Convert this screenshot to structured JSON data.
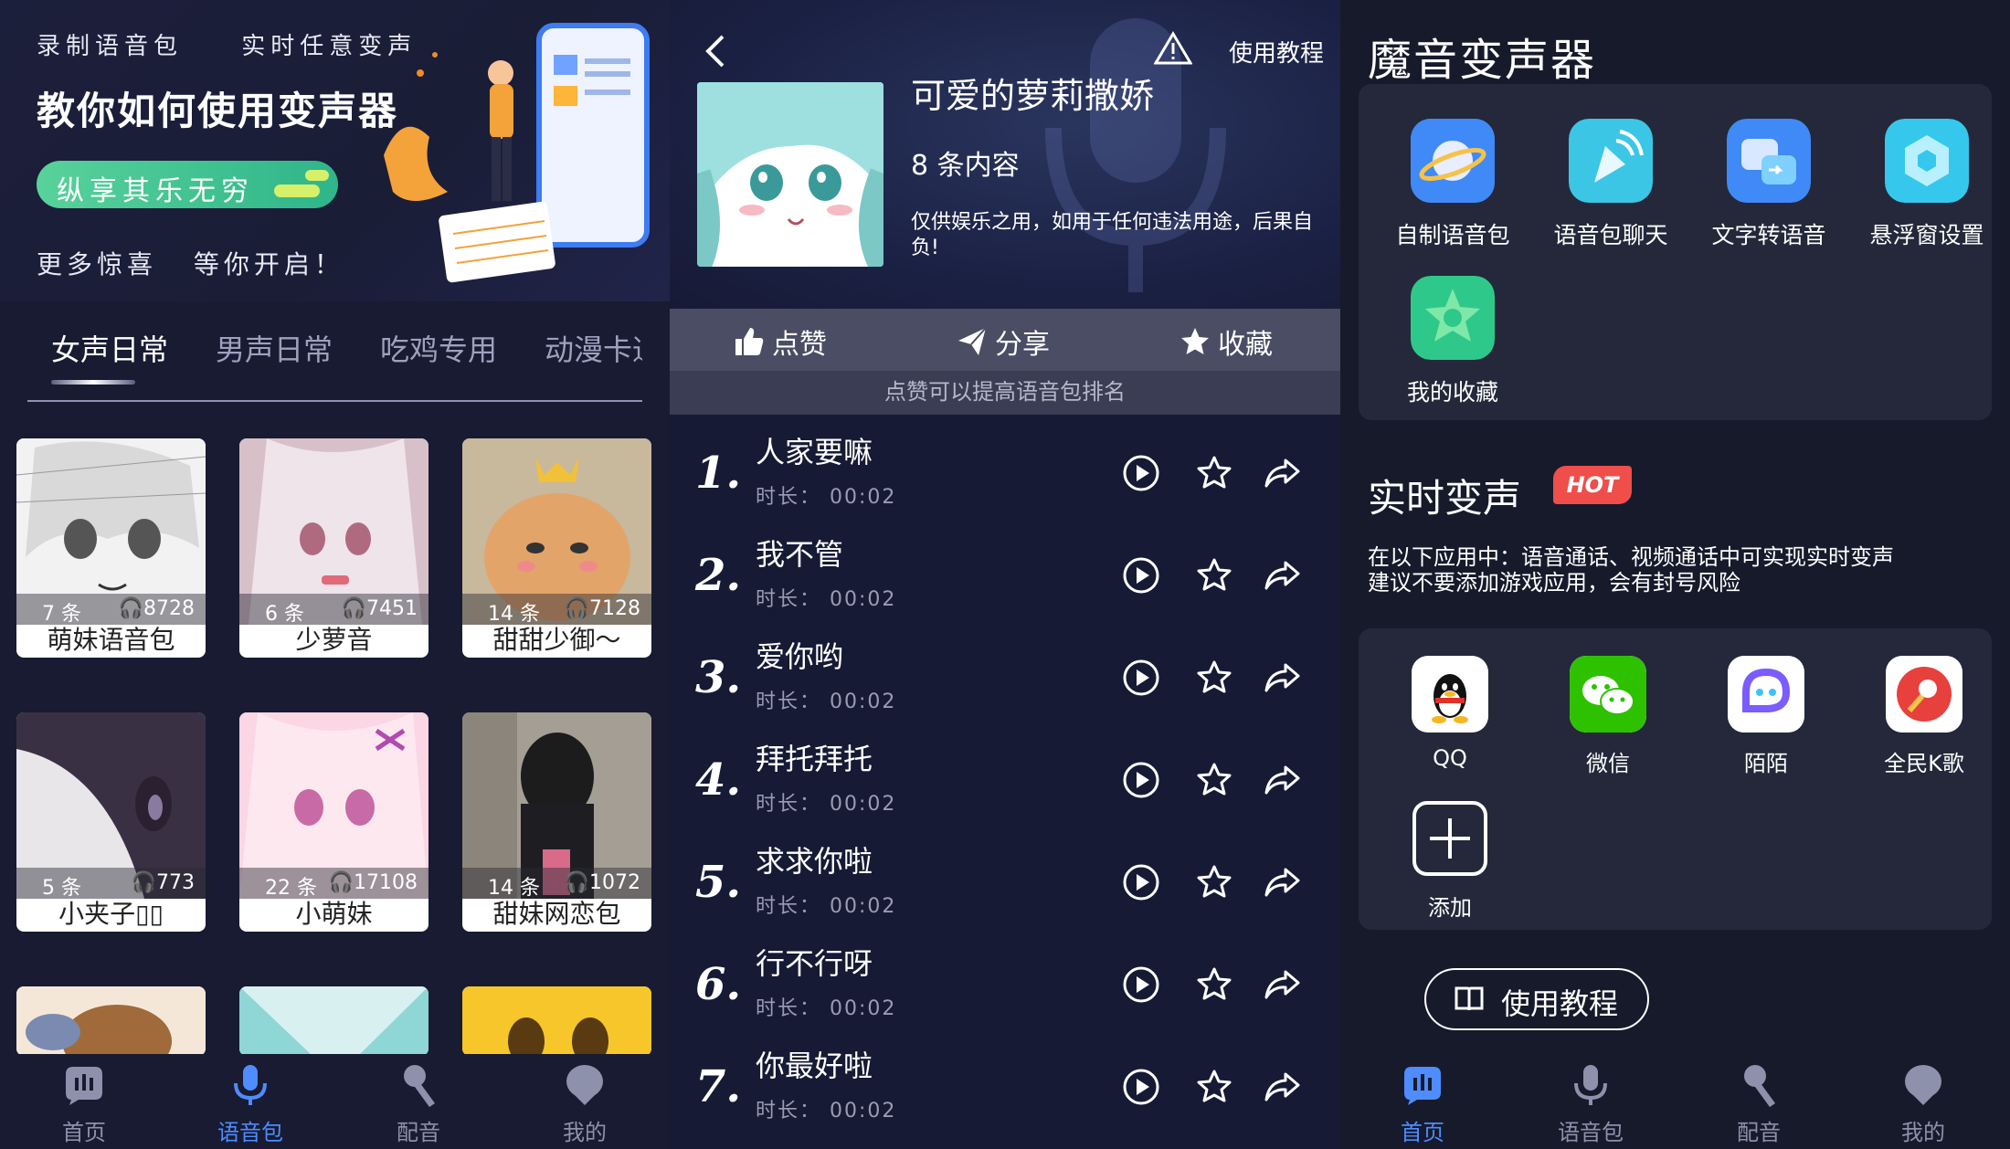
{
  "panel1": {
    "banner": {
      "top_left": "录制语音包",
      "top_right": "实时任意变声",
      "title": "教你如何使用变声器",
      "pill": "纵享其乐无穷",
      "sub_left": "更多惊喜",
      "sub_right": "等你开启！"
    },
    "tabs": [
      "女声日常",
      "男声日常",
      "吃鸡专用",
      "动漫卡通"
    ],
    "cards": [
      {
        "name": "萌妹语音包",
        "count": "7 条",
        "plays": "8728"
      },
      {
        "name": "少萝音",
        "count": "6 条",
        "plays": "7451"
      },
      {
        "name": "甜甜少御～",
        "count": "14 条",
        "plays": "7128"
      },
      {
        "name": "小夹子▯▯",
        "count": "5 条",
        "plays": "773"
      },
      {
        "name": "小萌妹",
        "count": "22 条",
        "plays": "17108"
      },
      {
        "name": "甜妹网恋包",
        "count": "14 条",
        "plays": "1072"
      }
    ],
    "nav": [
      "首页",
      "语音包",
      "配音",
      "我的"
    ],
    "nav_active": "语音包"
  },
  "panel2": {
    "tutorial": "使用教程",
    "title": "可爱的萝莉撒娇",
    "count": "8 条内容",
    "disclaimer": "仅供娱乐之用，如用于任何违法用途，后果自负!",
    "actions": {
      "like": "点赞",
      "share": "分享",
      "fav": "收藏"
    },
    "hint": "点赞可以提高语音包排名",
    "songs": [
      {
        "num": "1.",
        "title": "人家要嘛",
        "dur": "时长： 00:02"
      },
      {
        "num": "2.",
        "title": "我不管",
        "dur": "时长： 00:02"
      },
      {
        "num": "3.",
        "title": "爱你哟",
        "dur": "时长： 00:02"
      },
      {
        "num": "4.",
        "title": "拜托拜托",
        "dur": "时长： 00:02"
      },
      {
        "num": "5.",
        "title": "求求你啦",
        "dur": "时长： 00:02"
      },
      {
        "num": "6.",
        "title": "行不行呀",
        "dur": "时长： 00:02"
      },
      {
        "num": "7.",
        "title": "你最好啦",
        "dur": "时长： 00:02"
      }
    ]
  },
  "panel3": {
    "title": "魔音变声器",
    "tools": [
      "自制语音包",
      "语音包聊天",
      "文字转语音",
      "悬浮窗设置",
      "我的收藏"
    ],
    "realtime_title": "实时变声",
    "hot": "HOT",
    "desc1": "在以下应用中：语音通话、视频通话中可实现实时变声",
    "desc2": "建议不要添加游戏应用，会有封号风险",
    "apps": [
      "QQ",
      "微信",
      "陌陌",
      "全民K歌",
      "添加"
    ],
    "tutorial_button": "使用教程",
    "nav": [
      "首页",
      "语音包",
      "配音",
      "我的"
    ],
    "nav_active": "首页"
  },
  "colors": {
    "accent_blue": "#4e8cff",
    "pill_green": "#3cc08e",
    "hot_red": "#ef4e4a"
  }
}
